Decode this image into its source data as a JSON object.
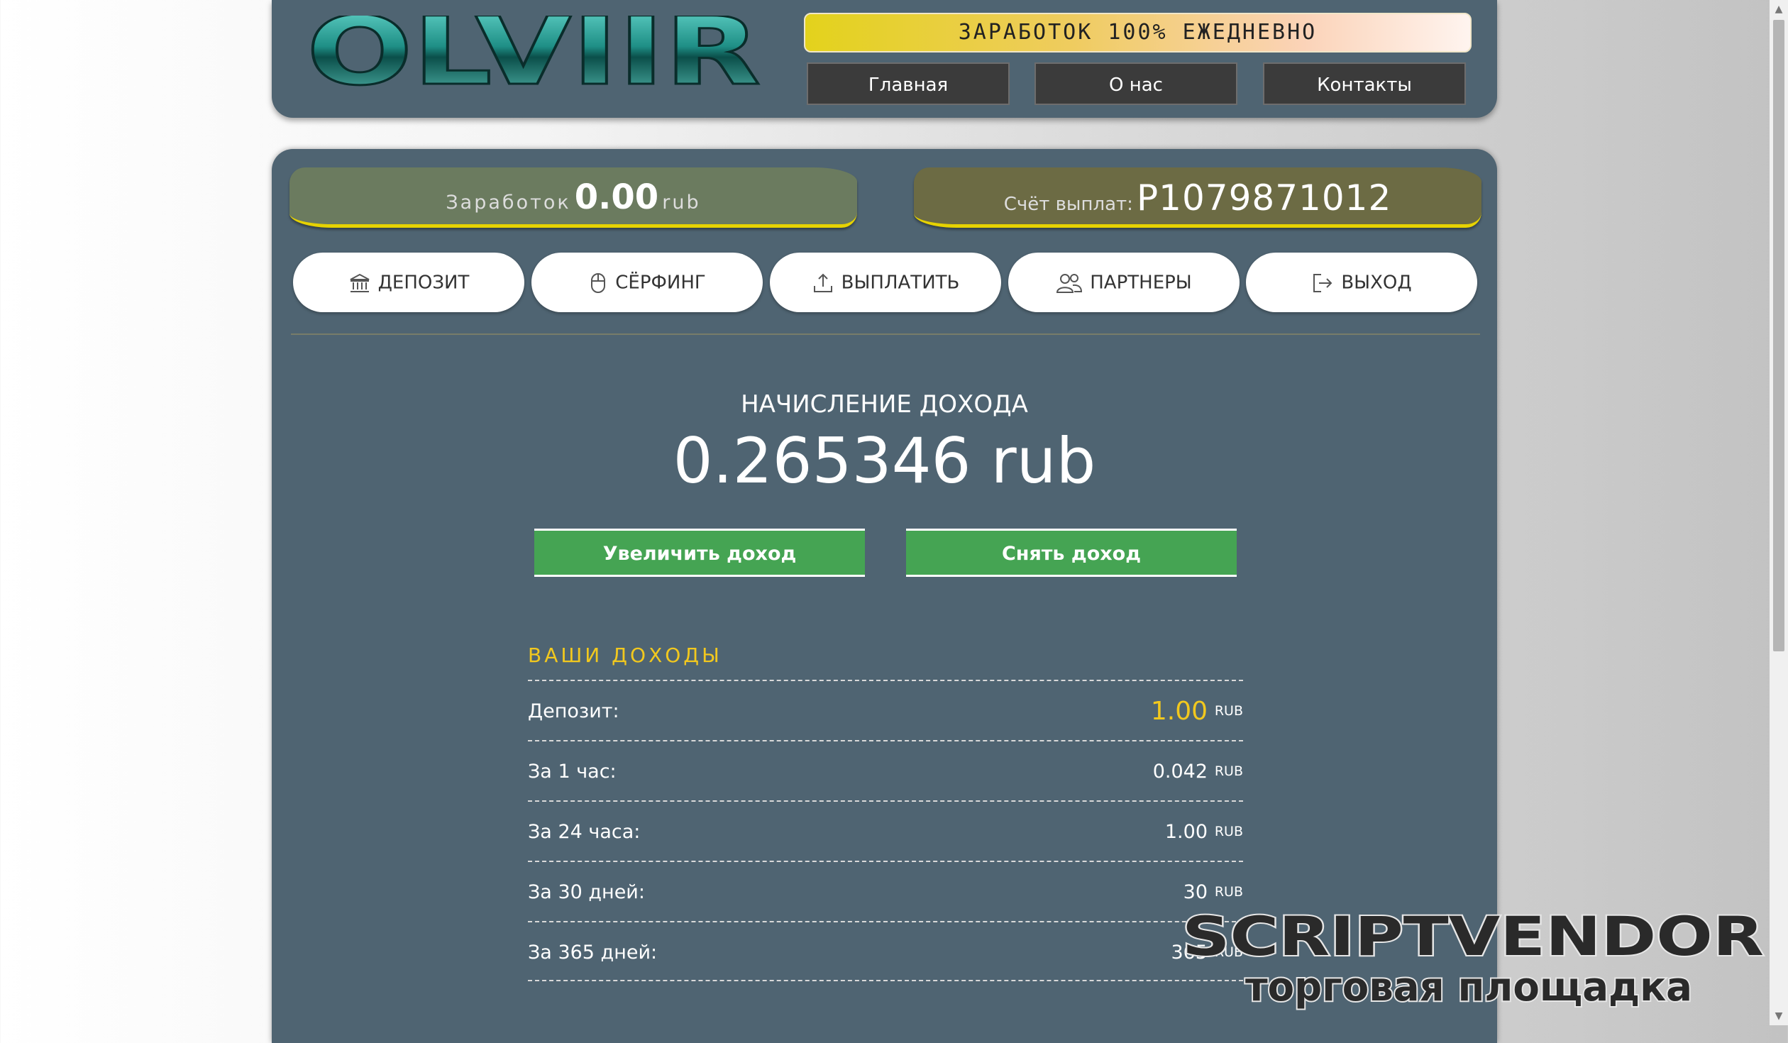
{
  "header": {
    "logo_text": "OLVIIR",
    "banner": "ЗАРАБОТОК 100% ЕЖЕДНЕВНО",
    "nav": [
      "Главная",
      "О нас",
      "Контакты"
    ]
  },
  "stats": {
    "earn_label": "Заработок",
    "earn_value": "0.00",
    "earn_unit": "rub",
    "wallet_label": "Счёт выплат:",
    "wallet_value": "P1079871012"
  },
  "menu": [
    {
      "label": "ДЕПОЗИТ",
      "icon": "bank-icon"
    },
    {
      "label": "СЁРФИНГ",
      "icon": "mouse-icon"
    },
    {
      "label": "ВЫПЛАТИТЬ",
      "icon": "upload-icon"
    },
    {
      "label": "ПАРТНЕРЫ",
      "icon": "users-icon"
    },
    {
      "label": "ВЫХОД",
      "icon": "logout-icon"
    }
  ],
  "income": {
    "title": "НАЧИСЛЕНИЕ ДОХОДА",
    "value": "0.265346 rub",
    "increase_btn": "Увеличить доход",
    "withdraw_btn": "Снять доход"
  },
  "earnings": {
    "heading": "ВАШИ ДОХОДЫ",
    "rows": [
      {
        "label": "Депозит:",
        "value": "1.00",
        "unit": "RUB"
      },
      {
        "label": "За 1 час:",
        "value": "0.042",
        "unit": "RUB"
      },
      {
        "label": "За 24 часа:",
        "value": "1.00",
        "unit": "RUB"
      },
      {
        "label": "За 30 дней:",
        "value": "30",
        "unit": "RUB"
      },
      {
        "label": "За 365 дней:",
        "value": "365",
        "unit": "RUB"
      }
    ]
  },
  "watermark": {
    "brand": "SCRIPTVENDOR",
    "subtitle": "торговая площадка"
  },
  "colors": {
    "panel": "#4f6472",
    "accent_yellow": "#f2c81e",
    "button_green": "#45a453"
  }
}
